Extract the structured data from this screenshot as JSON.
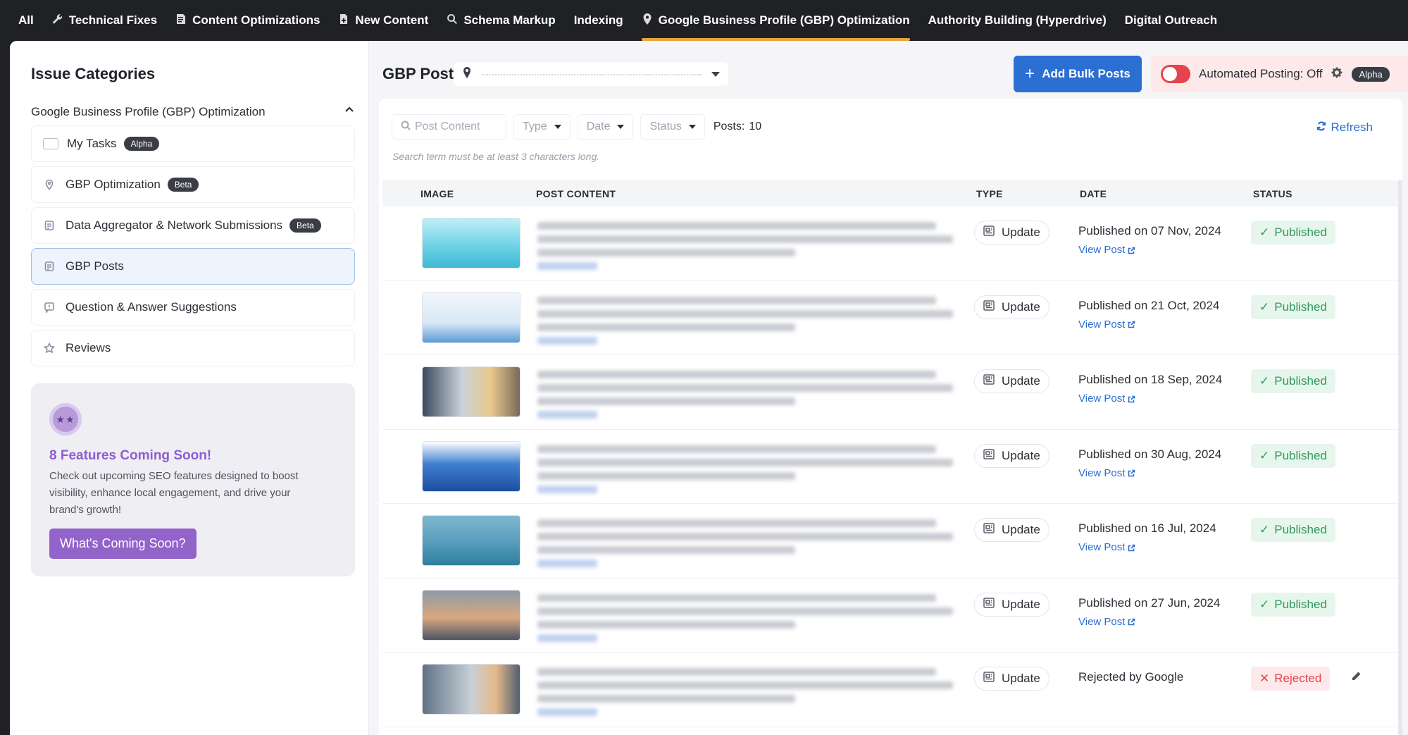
{
  "nav": {
    "items": [
      {
        "label": "All",
        "icon": "none"
      },
      {
        "label": "Technical Fixes",
        "icon": "wrench-icon"
      },
      {
        "label": "Content Optimizations",
        "icon": "content-icon"
      },
      {
        "label": "New Content",
        "icon": "file-icon"
      },
      {
        "label": "Schema Markup",
        "icon": "search-icon"
      },
      {
        "label": "Indexing",
        "icon": "none"
      },
      {
        "label": "Google Business Profile (GBP) Optimization",
        "icon": "pin-icon",
        "active": true
      },
      {
        "label": "Authority Building (Hyperdrive)",
        "icon": "none"
      },
      {
        "label": "Digital Outreach",
        "icon": "none"
      }
    ],
    "active_color": "#e9a33d"
  },
  "sidebar": {
    "title": "Issue Categories",
    "group_label": "Google Business Profile (GBP) Optimization",
    "items": [
      {
        "label": "My Tasks",
        "badge": "Alpha",
        "icon": "checkbox-icon"
      },
      {
        "label": "GBP Optimization",
        "badge": "Beta",
        "icon": "pin-icon"
      },
      {
        "label": "Data Aggregator & Network Submissions",
        "badge": "Beta",
        "icon": "document-icon"
      },
      {
        "label": "GBP Posts",
        "badge": "",
        "icon": "document-icon",
        "active": true
      },
      {
        "label": "Question & Answer Suggestions",
        "badge": "",
        "icon": "chat-icon"
      },
      {
        "label": "Reviews",
        "badge": "",
        "icon": "star-icon"
      }
    ],
    "promo": {
      "avatar": "★★",
      "title": "8 Features Coming Soon!",
      "text": "Check out upcoming SEO features designed to boost visibility, enhance local engagement, and drive your brand's growth!",
      "button": "What's Coming Soon?"
    }
  },
  "main": {
    "title": "GBP Posts",
    "add_bulk_label": "Add Bulk Posts",
    "auto_posting_label": "Automated Posting: Off",
    "auto_posting_badge": "Alpha",
    "filters": {
      "search_placeholder": "Post Content",
      "type": "Type",
      "date": "Date",
      "status": "Status",
      "posts_label": "Posts:",
      "posts_count": "10",
      "refresh": "Refresh",
      "hint": "Search term must be at least 3 characters long."
    },
    "columns": [
      "IMAGE",
      "POST CONTENT",
      "TYPE",
      "DATE",
      "STATUS"
    ],
    "rows": [
      {
        "type": "Update",
        "date": "Published on 07 Nov, 2024",
        "link": "View Post",
        "status": "Published",
        "status_kind": "published",
        "thumb": "solar-panels-illustration"
      },
      {
        "type": "Update",
        "date": "Published on 21 Oct, 2024",
        "link": "View Post",
        "status": "Published",
        "status_kind": "published",
        "thumb": "wind-turbine-illustration"
      },
      {
        "type": "Update",
        "date": "Published on 18 Sep, 2024",
        "link": "View Post",
        "status": "Published",
        "status_kind": "published",
        "thumb": "lab-photo"
      },
      {
        "type": "Update",
        "date": "Published on 30 Aug, 2024",
        "link": "View Post",
        "status": "Published",
        "status_kind": "published",
        "thumb": "hydrogen-plant-illustration"
      },
      {
        "type": "Update",
        "date": "Published on 16 Jul, 2024",
        "link": "View Post",
        "status": "Published",
        "status_kind": "published",
        "thumb": "offshore-wind-photo"
      },
      {
        "type": "Update",
        "date": "Published on 27 Jun, 2024",
        "link": "View Post",
        "status": "Published",
        "status_kind": "published",
        "thumb": "sunset-wind-photo"
      },
      {
        "type": "Update",
        "date": "Rejected by Google",
        "link": "",
        "status": "Rejected",
        "status_kind": "rejected",
        "thumb": "industrial-tower-photo"
      }
    ],
    "colors": {
      "primary": "#2b6fd3",
      "published": "#2f9a5c",
      "rejected": "#e5434d",
      "promo": "#9263c9"
    }
  }
}
